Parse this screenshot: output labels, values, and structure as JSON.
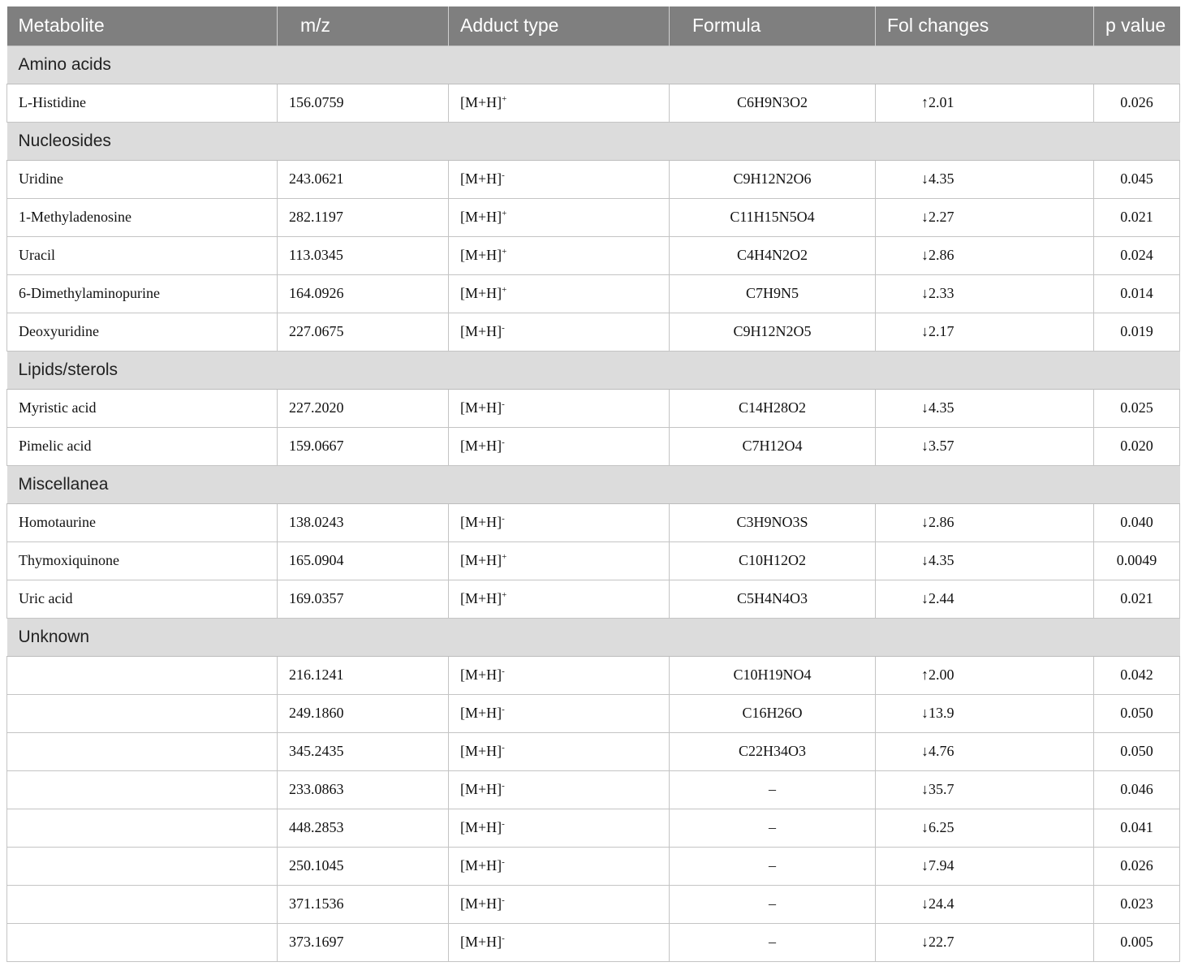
{
  "headers": [
    "Metabolite",
    "m/z",
    "Adduct type",
    "Formula",
    "Fol changes",
    "p value"
  ],
  "groups": [
    {
      "name": "Amino acids",
      "rows": [
        {
          "metabolite": "L-Histidine",
          "mz": "156.0759",
          "adduct": "[M+H]",
          "charge": "+",
          "formula": "C6H9N3O2",
          "fold": "↑2.01",
          "p": "0.026"
        }
      ]
    },
    {
      "name": "Nucleosides",
      "rows": [
        {
          "metabolite": "Uridine",
          "mz": "243.0621",
          "adduct": "[M+H]",
          "charge": "-",
          "formula": "C9H12N2O6",
          "fold": "↓4.35",
          "p": "0.045"
        },
        {
          "metabolite": "1-Methyladenosine",
          "mz": "282.1197",
          "adduct": "[M+H]",
          "charge": "+",
          "formula": "C11H15N5O4",
          "fold": "↓2.27",
          "p": "0.021"
        },
        {
          "metabolite": "Uracil",
          "mz": "113.0345",
          "adduct": "[M+H]",
          "charge": "+",
          "formula": "C4H4N2O2",
          "fold": "↓2.86",
          "p": "0.024"
        },
        {
          "metabolite": "6-Dimethylaminopurine",
          "mz": "164.0926",
          "adduct": "[M+H]",
          "charge": "+",
          "formula": "C7H9N5",
          "fold": "↓2.33",
          "p": "0.014"
        },
        {
          "metabolite": "Deoxyuridine",
          "mz": "227.0675",
          "adduct": "[M+H]",
          "charge": "-",
          "formula": "C9H12N2O5",
          "fold": "↓2.17",
          "p": "0.019"
        }
      ]
    },
    {
      "name": "Lipids/sterols",
      "rows": [
        {
          "metabolite": "Myristic acid",
          "mz": "227.2020",
          "adduct": "[M+H]",
          "charge": "-",
          "formula": "C14H28O2",
          "fold": "↓4.35",
          "p": "0.025"
        },
        {
          "metabolite": "Pimelic acid",
          "mz": "159.0667",
          "adduct": "[M+H]",
          "charge": "-",
          "formula": "C7H12O4",
          "fold": "↓3.57",
          "p": "0.020"
        }
      ]
    },
    {
      "name": "Miscellanea",
      "rows": [
        {
          "metabolite": "Homotaurine",
          "mz": "138.0243",
          "adduct": "[M+H]",
          "charge": "-",
          "formula": "C3H9NO3S",
          "fold": "↓2.86",
          "p": "0.040"
        },
        {
          "metabolite": "Thymoxiquinone",
          "mz": "165.0904",
          "adduct": "[M+H]",
          "charge": "+",
          "formula": "C10H12O2",
          "fold": "↓4.35",
          "p": "0.0049"
        },
        {
          "metabolite": "Uric acid",
          "mz": "169.0357",
          "adduct": "[M+H]",
          "charge": "+",
          "formula": "C5H4N4O3",
          "fold": "↓2.44",
          "p": "0.021"
        }
      ]
    },
    {
      "name": "Unknown",
      "rows": [
        {
          "metabolite": "",
          "mz": "216.1241",
          "adduct": "[M+H]",
          "charge": "-",
          "formula": "C10H19NO4",
          "fold": "↑2.00",
          "p": "0.042"
        },
        {
          "metabolite": "",
          "mz": "249.1860",
          "adduct": "[M+H]",
          "charge": "-",
          "formula": "C16H26O",
          "fold": "↓13.9",
          "p": "0.050"
        },
        {
          "metabolite": "",
          "mz": "345.2435",
          "adduct": "[M+H]",
          "charge": "-",
          "formula": "C22H34O3",
          "fold": "↓4.76",
          "p": "0.050"
        },
        {
          "metabolite": "",
          "mz": "233.0863",
          "adduct": "[M+H]",
          "charge": "-",
          "formula": "–",
          "fold": "↓35.7",
          "p": "0.046"
        },
        {
          "metabolite": "",
          "mz": "448.2853",
          "adduct": "[M+H]",
          "charge": "-",
          "formula": "–",
          "fold": "↓6.25",
          "p": "0.041"
        },
        {
          "metabolite": "",
          "mz": "250.1045",
          "adduct": "[M+H]",
          "charge": "-",
          "formula": "–",
          "fold": "↓7.94",
          "p": "0.026"
        },
        {
          "metabolite": "",
          "mz": "371.1536",
          "adduct": "[M+H]",
          "charge": "-",
          "formula": "–",
          "fold": "↓24.4",
          "p": "0.023"
        },
        {
          "metabolite": "",
          "mz": "373.1697",
          "adduct": "[M+H]",
          "charge": "-",
          "formula": "–",
          "fold": "↓22.7",
          "p": "0.005"
        }
      ]
    }
  ],
  "colors": {
    "header_bg": "#7f7f7f",
    "header_text": "#ffffff",
    "section_bg": "#dcdcdc",
    "grid_line": "#c4c4c4"
  }
}
